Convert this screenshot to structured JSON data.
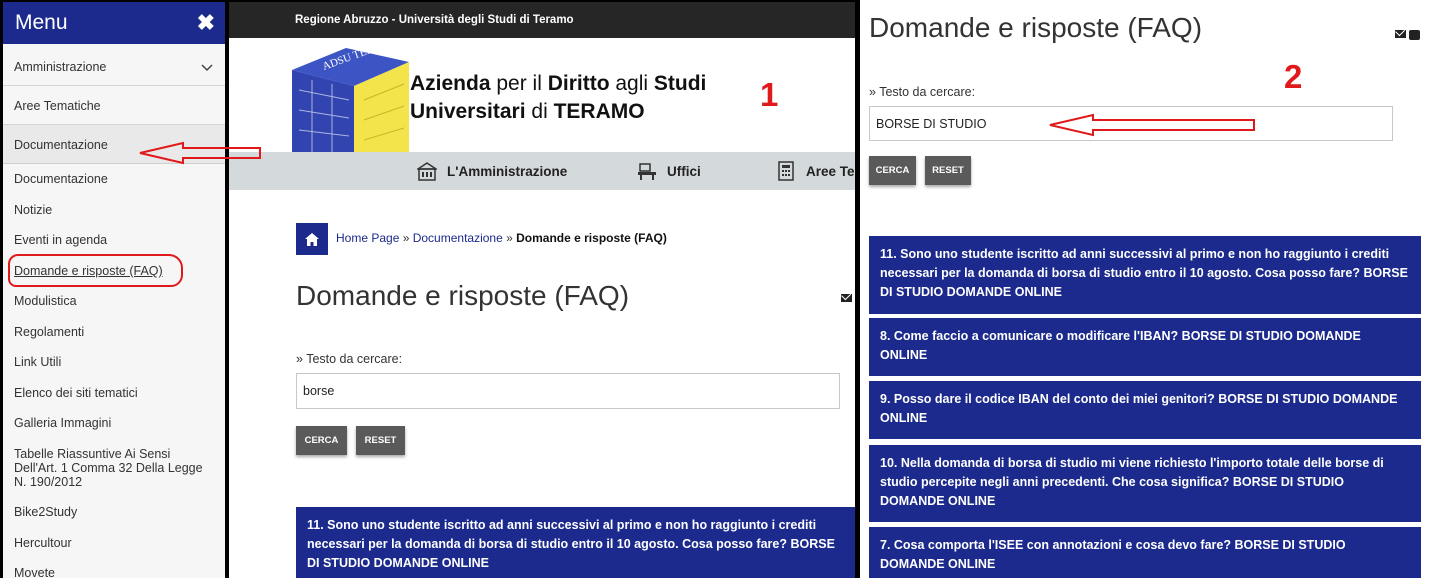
{
  "menu": {
    "title": "Menu",
    "close_icon": "✖",
    "items": [
      {
        "label": "Amministrazione"
      },
      {
        "label": "Aree Tematiche"
      },
      {
        "label": "Documentazione"
      },
      {
        "label": "Documentazione"
      },
      {
        "label": "Notizie"
      },
      {
        "label": "Eventi in agenda"
      },
      {
        "label": "Domande e risposte (FAQ)"
      },
      {
        "label": "Modulistica"
      },
      {
        "label": "Regolamenti"
      },
      {
        "label": "Link Utili"
      },
      {
        "label": "Elenco dei siti tematici"
      },
      {
        "label": "Galleria Immagini"
      },
      {
        "label": "Tabelle Riassuntive Ai Sensi Dell'Art. 1 Comma 32 Della Legge N. 190/2012"
      },
      {
        "label": "Bike2Study"
      },
      {
        "label": "Hercultour"
      },
      {
        "label": "Movete"
      }
    ]
  },
  "page1": {
    "topbar": "Regione Abruzzo - Università degli Studi di Teramo",
    "logo_text": "ADSU TERAMO",
    "brand": {
      "w1": "Azienda",
      "w2": " per il ",
      "w3": "Diritto",
      "w4": " agli ",
      "w5": "Studi",
      "w6": "Universitari",
      "w7": " di ",
      "w8": "TERAMO"
    },
    "annotation_number": "1",
    "nav": [
      "L'Amministrazione",
      "Uffici",
      "Aree Te"
    ],
    "breadcrumb": {
      "home": "Home Page",
      "sep": " » ",
      "section": "Documentazione",
      "current": "Domande e risposte (FAQ)"
    },
    "title": "Domande e risposte (FAQ)",
    "search_label": "» Testo da cercare:",
    "search_value": "borse",
    "btn_search": "CERCA",
    "btn_reset": "RESET",
    "results": [
      "11. Sono uno studente iscritto ad anni successivi al primo e non ho raggiunto i crediti necessari per la domanda di borsa di studio entro il 10 agosto. Cosa posso fare? BORSE DI STUDIO DOMANDE ONLINE"
    ]
  },
  "page2": {
    "title": "Domande e risposte (FAQ)",
    "annotation_number": "2",
    "search_label": "» Testo da cercare:",
    "search_value": "BORSE DI STUDIO",
    "btn_search": "CERCA",
    "btn_reset": "RESET",
    "results": [
      "11. Sono uno studente iscritto ad anni successivi al primo e non ho raggiunto i crediti necessari per la domanda di borsa di studio entro il 10 agosto. Cosa posso fare? BORSE DI STUDIO DOMANDE ONLINE",
      "8. Come faccio a comunicare o modificare l'IBAN? BORSE DI STUDIO DOMANDE ONLINE",
      "9. Posso dare il codice IBAN del conto dei miei genitori? BORSE DI STUDIO DOMANDE ONLINE",
      "10. Nella domanda di borsa di studio mi viene richiesto l'importo totale delle borse di studio percepite negli anni precedenti. Che cosa significa? BORSE DI STUDIO DOMANDE ONLINE",
      "7. Cosa comporta l'ISEE con annotazioni e cosa devo fare? BORSE DI STUDIO DOMANDE ONLINE"
    ]
  },
  "colors": {
    "brand_blue": "#1b2a8c",
    "annotation_red": "#e0191b",
    "button_gray": "#5a5a5a"
  }
}
